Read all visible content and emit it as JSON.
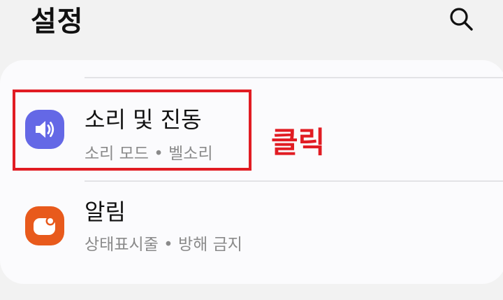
{
  "header": {
    "title": "설정",
    "search_icon": "search-icon"
  },
  "settings": {
    "items": [
      {
        "title": "소리 및 진동",
        "subtitle": "소리 모드 • 벨소리",
        "icon": "speaker-icon",
        "icon_color": "#6468e6"
      },
      {
        "title": "알림",
        "subtitle": "상태표시줄 • 방해 금지",
        "icon": "notification-icon",
        "icon_color": "#e85a1c"
      }
    ]
  },
  "annotation": {
    "label": "클릭",
    "color": "#e11c23"
  }
}
